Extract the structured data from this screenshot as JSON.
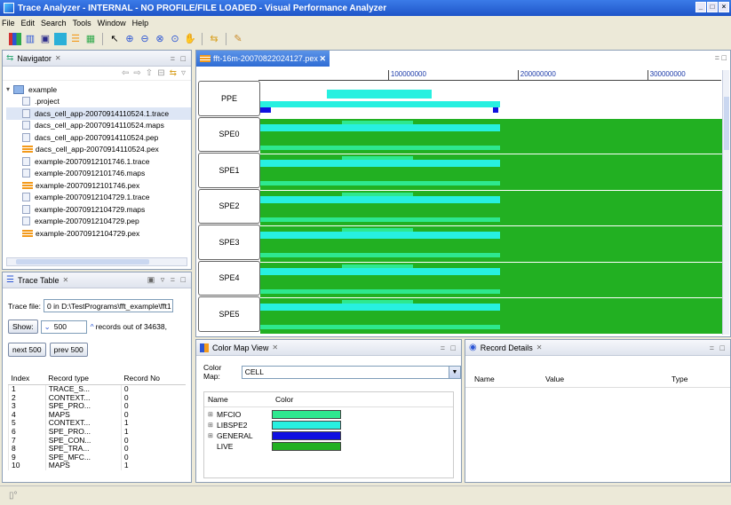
{
  "window": {
    "title": "Trace Analyzer - INTERNAL - NO PROFILE/FILE LOADED - Visual Performance Analyzer"
  },
  "menu": [
    "File",
    "Edit",
    "Search",
    "Tools",
    "Window",
    "Help"
  ],
  "toolbar_icons": [
    "chart-bars-icon",
    "chart-columns-icon",
    "monitor-icon",
    "trace-icon",
    "pex-icon",
    "timeline-icon",
    "pointer-icon",
    "zoom-in-icon",
    "zoom-out-icon",
    "zoom-fit-icon",
    "zoom-region-icon",
    "pan-icon",
    "sync-icon",
    "marker-icon"
  ],
  "navigator": {
    "title": "Navigator",
    "root": "example",
    "files": [
      {
        "name": ".project",
        "type": "file"
      },
      {
        "name": "dacs_cell_app-20070914110524.1.trace",
        "type": "file",
        "selected": true
      },
      {
        "name": "dacs_cell_app-20070914110524.maps",
        "type": "file"
      },
      {
        "name": "dacs_cell_app-20070914110524.pep",
        "type": "file"
      },
      {
        "name": "dacs_cell_app-20070914110524.pex",
        "type": "pex"
      },
      {
        "name": "example-20070912101746.1.trace",
        "type": "file"
      },
      {
        "name": "example-20070912101746.maps",
        "type": "file"
      },
      {
        "name": "example-20070912101746.pex",
        "type": "pex"
      },
      {
        "name": "example-20070912104729.1.trace",
        "type": "file"
      },
      {
        "name": "example-20070912104729.maps",
        "type": "file"
      },
      {
        "name": "example-20070912104729.pep",
        "type": "file"
      },
      {
        "name": "example-20070912104729.pex",
        "type": "pex"
      }
    ]
  },
  "trace_table": {
    "title": "Trace Table",
    "trace_file_label": "Trace file:",
    "trace_file_value": "0 in D:\\TestPrograms\\fft_example\\fft1",
    "show_label": "Show:",
    "show_value": "500",
    "records_text": "records out of 34638, f",
    "next_label": "next 500",
    "prev_label": "prev 500",
    "columns": [
      "Index",
      "Record type",
      "Record No"
    ],
    "rows": [
      [
        "1",
        "TRACE_S...",
        "0"
      ],
      [
        "2",
        "CONTEXT...",
        "0"
      ],
      [
        "3",
        "SPE_PRO...",
        "0"
      ],
      [
        "4",
        "MAPS",
        "0"
      ],
      [
        "5",
        "CONTEXT...",
        "1"
      ],
      [
        "6",
        "SPE_PRO...",
        "1"
      ],
      [
        "7",
        "SPE_CON...",
        "0"
      ],
      [
        "8",
        "SPE_TRA...",
        "0"
      ],
      [
        "9",
        "SPE_MFC...",
        "0"
      ],
      [
        "10",
        "MAPS",
        "1"
      ]
    ]
  },
  "timeline": {
    "tab_label": "fft-16m-20070822024127.pex",
    "ruler_ticks": [
      {
        "label": "100000000",
        "position": 0.28
      },
      {
        "label": "200000000",
        "position": 0.56
      },
      {
        "label": "300000000",
        "position": 0.84
      }
    ],
    "processors": [
      "PPE",
      "SPE0",
      "SPE1",
      "SPE2",
      "SPE3",
      "SPE4",
      "SPE5"
    ],
    "colors": {
      "live": "#22b022",
      "libspe2": "#27f0e0",
      "mfcio": "#2ee88f",
      "general": "#1010e0"
    }
  },
  "color_map": {
    "title": "Color Map View",
    "label": "Color Map:",
    "value": "CELL",
    "columns": [
      "Name",
      "Color"
    ],
    "entries": [
      {
        "name": "MFCIO",
        "color": "#2ee88f",
        "expandable": true
      },
      {
        "name": "LIBSPE2",
        "color": "#27f0e0",
        "expandable": true
      },
      {
        "name": "GENERAL",
        "color": "#1010e0",
        "expandable": true
      },
      {
        "name": "LIVE",
        "color": "#22b022",
        "expandable": false
      }
    ]
  },
  "record_details": {
    "title": "Record Details",
    "columns": [
      "Name",
      "Value",
      "Type"
    ]
  },
  "status": {
    "icon": "status-icon"
  }
}
